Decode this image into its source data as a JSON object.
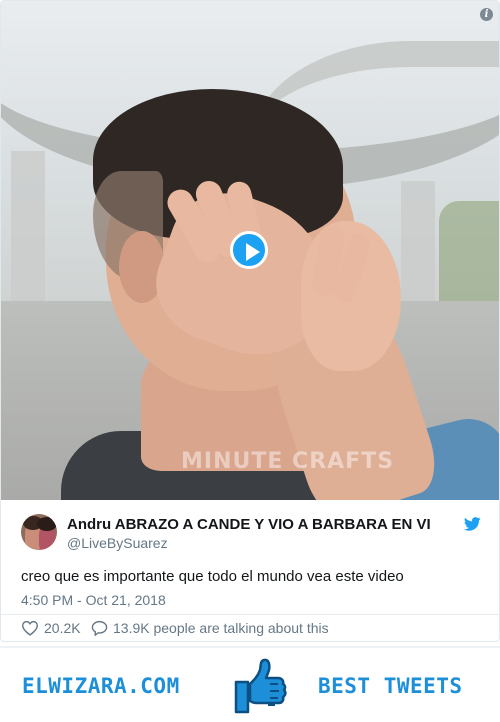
{
  "media": {
    "watermark": "MINUTE CRAFTS",
    "info_icon": "info-icon",
    "play_icon": "play-icon"
  },
  "tweet": {
    "display_name": "Andru ABRAZO A CANDE Y VIO A BARBARA EN VI",
    "handle": "@LiveBySuarez",
    "text": "creo que es importante que todo el mundo vea este video",
    "timestamp": "4:50 PM - Oct 21, 2018",
    "likes": "20.2K",
    "talking": "13.9K people are talking about this",
    "brand_icon": "twitter-bird-icon"
  },
  "footer": {
    "left_text": "ELWIZARA.COM",
    "right_text": "BEST TWEETS",
    "center_icon": "thumbs-up-icon"
  },
  "colors": {
    "accent": "#1da1f2",
    "footer_text": "#1d8fd8",
    "secondary_text": "#657786"
  }
}
